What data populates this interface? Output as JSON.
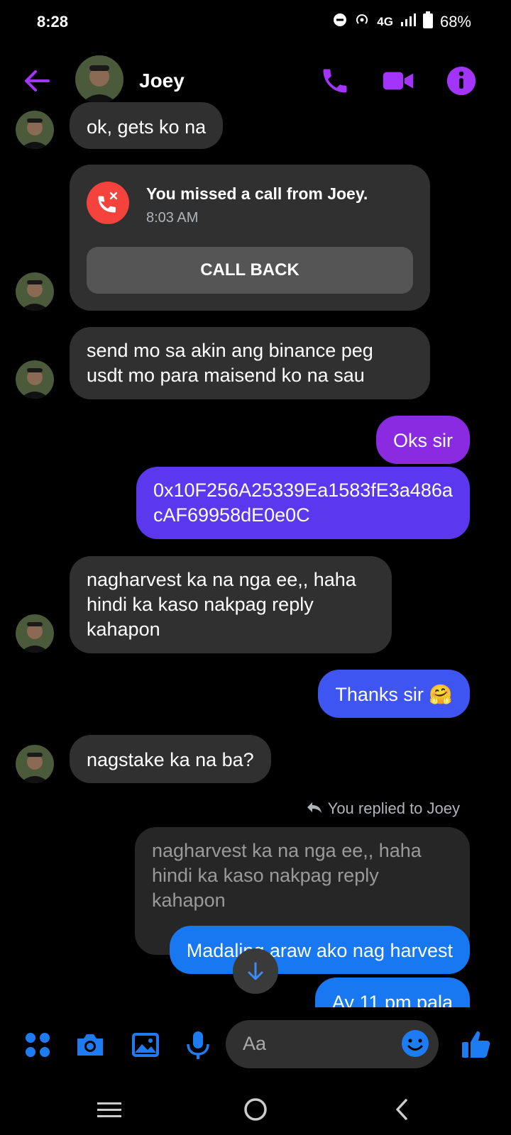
{
  "status_bar": {
    "time": "8:28",
    "network": "4G",
    "battery": "68%"
  },
  "header": {
    "contact_name": "Joey"
  },
  "colors": {
    "accent": "#a334fa",
    "incoming_bubble": "#303030",
    "missed_call_red": "#f4423c",
    "messenger_blue": "#1778f2"
  },
  "messages": {
    "m1": "ok, gets ko na",
    "missed_call": {
      "title": "You missed a call from Joey.",
      "time": "8:03 AM",
      "button": "CALL BACK"
    },
    "m2": "send mo sa akin ang binance peg usdt mo para maisend ko na sau",
    "m3": "Oks sir",
    "m4": "0x10F256A25339Ea1583fE3a486acAF69958dE0e0C",
    "m5": "nagharvest ka na nga ee,, haha hindi ka kaso nakpag reply kahapon",
    "m6": "Thanks sir 🤗",
    "m7": "nagstake ka na ba?",
    "reply_header": "You replied to Joey",
    "quoted": "nagharvest ka na nga ee,, haha hindi ka kaso nakpag reply kahapon",
    "m8": "Madaling araw ako nag harvest",
    "m9": "Ay 11 pm pala"
  },
  "composer": {
    "placeholder": "Aa"
  }
}
